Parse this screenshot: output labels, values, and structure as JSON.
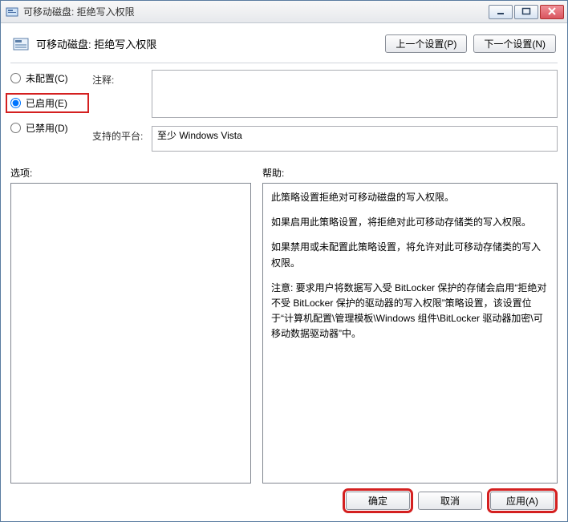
{
  "window": {
    "title": "可移动磁盘: 拒绝写入权限"
  },
  "header": {
    "title": "可移动磁盘: 拒绝写入权限",
    "prev_setting": "上一个设置(P)",
    "next_setting": "下一个设置(N)"
  },
  "radios": {
    "not_configured": "未配置(C)",
    "enabled": "已启用(E)",
    "disabled": "已禁用(D)",
    "selected": "enabled"
  },
  "fields": {
    "comment_label": "注释:",
    "comment_value": "",
    "platform_label": "支持的平台:",
    "platform_value": "至少 Windows Vista"
  },
  "lower": {
    "options_label": "选项:",
    "help_label": "帮助:"
  },
  "help_text": {
    "p1": "此策略设置拒绝对可移动磁盘的写入权限。",
    "p2": "如果启用此策略设置，将拒绝对此可移动存储类的写入权限。",
    "p3": "如果禁用或未配置此策略设置，将允许对此可移动存储类的写入权限。",
    "p4": "注意: 要求用户将数据写入受 BitLocker 保护的存储会启用“拒绝对不受 BitLocker 保护的驱动器的写入权限”策略设置，该设置位于“计算机配置\\管理模板\\Windows 组件\\BitLocker 驱动器加密\\可移动数据驱动器”中。"
  },
  "footer": {
    "ok": "确定",
    "cancel": "取消",
    "apply": "应用(A)"
  }
}
